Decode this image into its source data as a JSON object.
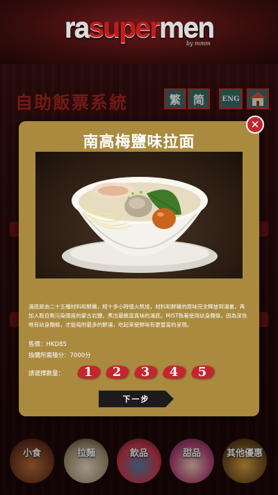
{
  "header": {
    "logo_prefix": "ra",
    "logo_mid": "super",
    "logo_suffix": "men",
    "logo_by": "by mmm"
  },
  "page": {
    "system_title": "自助飯票系統",
    "lang_buttons": [
      "繁",
      "简",
      "ENG"
    ]
  },
  "categories": [
    {
      "label": "小食"
    },
    {
      "label": "拉麵"
    },
    {
      "label": "飲品"
    },
    {
      "label": "甜品"
    },
    {
      "label": "其他優惠"
    }
  ],
  "modal": {
    "title": "南高梅鹽味拉面",
    "description": "湯底是由二十五種材料和鮮雞，經十多小時慢火熬成，材料和鮮雞的原味完全釋放到湯裏，再加入取自無污染國度的蒙古岩鹽，煮出最饒富真味的湯底。MIST執著使用幼身麵條，因為深信唯有幼身麵條，才能吸附最多的鮮湯，吃起來使鮮味有更豐富的呈現。",
    "price": "售價：HKD85",
    "points": "換購所需積分：7000分",
    "quantity_label": "請選擇數量：",
    "quantities": [
      "1",
      "2",
      "3",
      "4",
      "5"
    ],
    "next_label": "下一步"
  },
  "colors": {
    "modal_bg": "#a98a3f",
    "accent_red": "#c3262c",
    "lang_teal": "#3b6b66"
  }
}
